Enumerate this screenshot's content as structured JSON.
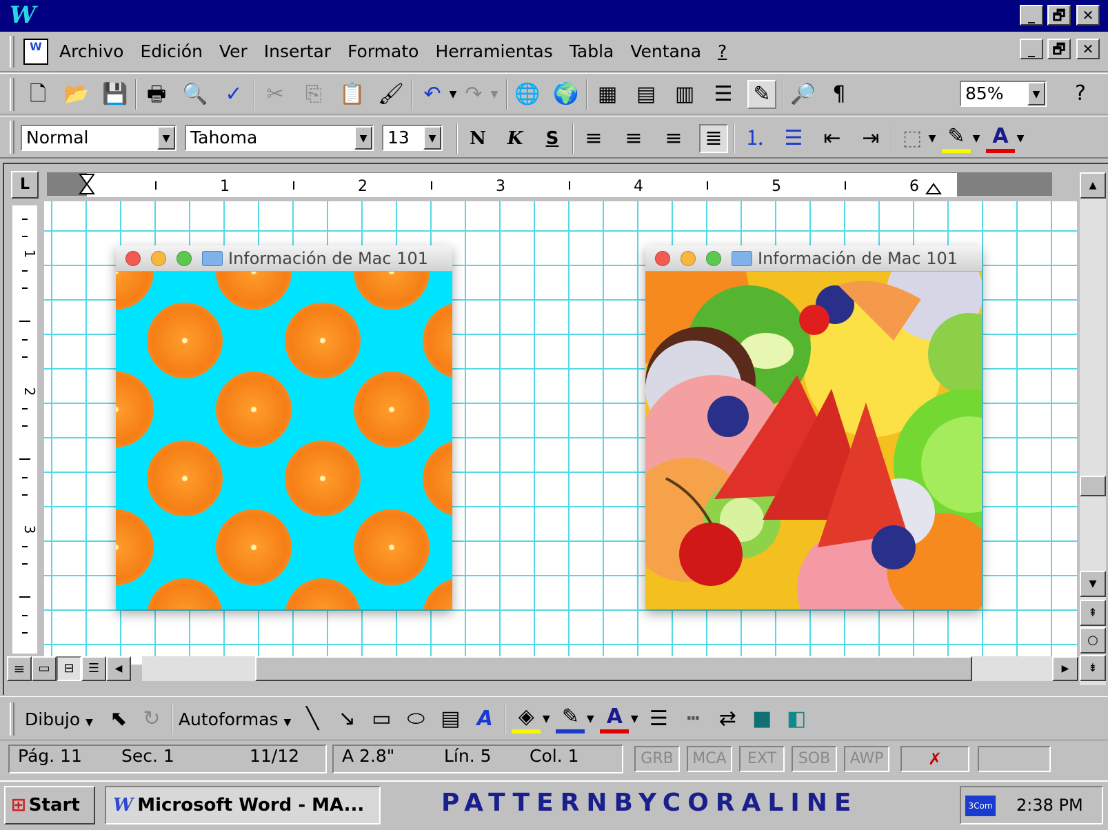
{
  "app": {
    "logo_letter": "W"
  },
  "window_controls": {
    "minimize": "_",
    "restore": "🗗",
    "close": "✕"
  },
  "menu": [
    "Archivo",
    "Edición",
    "Ver",
    "Insertar",
    "Formato",
    "Herramientas",
    "Tabla",
    "Ventana",
    "?"
  ],
  "formatting": {
    "style": "Normal",
    "font": "Tahoma",
    "size": "13",
    "zoom": "85%",
    "bold": "N",
    "italic": "K",
    "underline": "S"
  },
  "ruler": {
    "marks": [
      "1",
      "2",
      "3",
      "4",
      "5",
      "6"
    ],
    "vmarks": [
      "1",
      "2",
      "3"
    ]
  },
  "mac_windows": [
    {
      "title": "Información de Mac 101"
    },
    {
      "title": "Información de Mac 101"
    }
  ],
  "drawing": {
    "dibujo": "Dibujo",
    "autoformas": "Autoformas"
  },
  "status": {
    "page": "Pág. 11",
    "section": "Sec. 1",
    "pages": "11/12",
    "at": "A 2.8\"",
    "line": "Lín. 5",
    "col": "Col. 1",
    "modes": [
      "GRB",
      "MCA",
      "EXT",
      "SOB",
      "AWP"
    ]
  },
  "taskbar": {
    "start": "Start",
    "task": "Microsoft Word - MA...",
    "brand": "PATTERNBYCORALINE",
    "tray_icon": "3Com",
    "time": "2:38 PM"
  },
  "colors": {
    "titlebar": "#000080",
    "grid": "#52d9e6",
    "orange_bg": "#00e5ff",
    "brand": "#1a1f8c"
  }
}
